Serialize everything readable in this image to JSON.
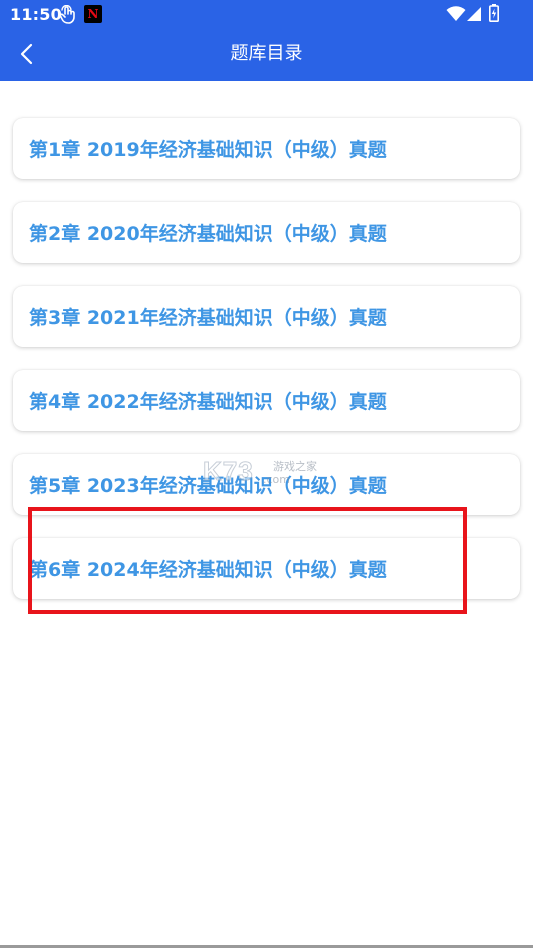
{
  "status_bar": {
    "time": "11:50",
    "app_icon_letter": "N",
    "icons": [
      "gesture-icon",
      "netflix-icon",
      "wifi-icon",
      "signal-icon",
      "battery-icon"
    ]
  },
  "toolbar": {
    "title": "题库目录",
    "back_icon": "chevron-left-icon",
    "color": "#2a63e6"
  },
  "chapters": [
    {
      "label": "第1章 2019年经济基础知识（中级）真题"
    },
    {
      "label": "第2章 2020年经济基础知识（中级）真题"
    },
    {
      "label": "第3章 2021年经济基础知识（中级）真题"
    },
    {
      "label": "第4章 2022年经济基础知识（中级）真题"
    },
    {
      "label": "第5章 2023年经济基础知识（中级）真题"
    },
    {
      "label": "第6章 2024年经济基础知识（中级）真题"
    }
  ],
  "watermark": {
    "logo": "K73",
    "sub": "游戏之家",
    "domain": ".com"
  },
  "colors": {
    "chapter_text": "#3f96e4",
    "highlight": "#e8141b"
  }
}
